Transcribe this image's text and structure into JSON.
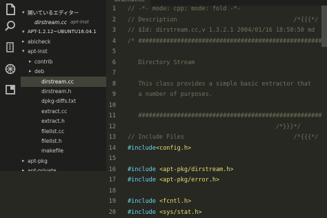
{
  "sidebar": {
    "open_editors_label": "開いているエディター",
    "open_file_name": "dirstream.cc",
    "open_file_folder": "apt-inst",
    "workspace_label": "APT-1.2.12~UBUNTU16.04.1",
    "tree": [
      {
        "label": "abicheck",
        "expanded": false,
        "folder": true
      },
      {
        "label": "apt-inst",
        "expanded": true,
        "folder": true
      },
      {
        "label": "contrib",
        "expanded": false,
        "folder": true
      },
      {
        "label": "deb",
        "expanded": false,
        "folder": true
      },
      {
        "label": "dirstream.cc",
        "selected": true
      },
      {
        "label": "dirstream.h"
      },
      {
        "label": "dpkg-diffs.txt"
      },
      {
        "label": "extract.cc"
      },
      {
        "label": "extract.h"
      },
      {
        "label": "filelist.cc"
      },
      {
        "label": "filelist.h"
      },
      {
        "label": "makefile"
      },
      {
        "label": "apt-pkg",
        "expanded": false,
        "folder": true
      },
      {
        "label": "apt-private",
        "expanded": false,
        "folder": true
      }
    ]
  },
  "activity_icons": [
    "files-icon",
    "search-icon",
    "source-control-icon",
    "debug-icon",
    "extensions-icon"
  ],
  "editor": {
    "lines": [
      {
        "n": "1",
        "parts": [
          {
            "c": "cm",
            "t": "// -*- mode: cpp; mode: fold -*-"
          }
        ]
      },
      {
        "n": "2",
        "parts": [
          {
            "c": "cm",
            "t": "// Description                                 /*{{{*/"
          }
        ]
      },
      {
        "n": "3",
        "parts": [
          {
            "c": "cm",
            "t": "// $Id: dirstream.cc,v 1.3.2.1 2004/01/16 18:58:50 md"
          }
        ]
      },
      {
        "n": "4",
        "parts": [
          {
            "c": "cm",
            "t": "/* ######################################################"
          }
        ]
      },
      {
        "n": "5",
        "parts": [
          {
            "c": "cm",
            "t": ""
          }
        ]
      },
      {
        "n": "6",
        "parts": [
          {
            "c": "cm",
            "t": "   Directory Stream"
          }
        ]
      },
      {
        "n": "7",
        "parts": [
          {
            "c": "cm",
            "t": ""
          }
        ]
      },
      {
        "n": "8",
        "parts": [
          {
            "c": "cm",
            "t": "   This class provides a simple basic extractor that"
          }
        ]
      },
      {
        "n": "9",
        "parts": [
          {
            "c": "cm",
            "t": "   a number of purposes."
          }
        ]
      },
      {
        "n": "10",
        "parts": [
          {
            "c": "cm",
            "t": ""
          }
        ]
      },
      {
        "n": "11",
        "parts": [
          {
            "c": "cm",
            "t": "   ####################################################"
          }
        ]
      },
      {
        "n": "12",
        "parts": [
          {
            "c": "cm",
            "t": "                                          /*}}}*/"
          }
        ]
      },
      {
        "n": "13",
        "parts": [
          {
            "c": "cm",
            "t": "// Include Files                               /*{{{*/"
          }
        ]
      },
      {
        "n": "14",
        "parts": [
          {
            "c": "kw",
            "t": "#include"
          },
          {
            "c": "str",
            "t": "<config.h>"
          }
        ]
      },
      {
        "n": "15",
        "parts": [
          {
            "c": "plain",
            "t": ""
          }
        ]
      },
      {
        "n": "16",
        "parts": [
          {
            "c": "kw",
            "t": "#include "
          },
          {
            "c": "str",
            "t": "<apt-pkg/dirstream.h>"
          }
        ]
      },
      {
        "n": "17",
        "parts": [
          {
            "c": "kw",
            "t": "#include "
          },
          {
            "c": "str",
            "t": "<apt-pkg/error.h>"
          }
        ]
      },
      {
        "n": "18",
        "parts": [
          {
            "c": "plain",
            "t": ""
          }
        ]
      },
      {
        "n": "19",
        "parts": [
          {
            "c": "kw",
            "t": "#include "
          },
          {
            "c": "str",
            "t": "<fcntl.h>"
          }
        ]
      },
      {
        "n": "20",
        "parts": [
          {
            "c": "kw",
            "t": "#include "
          },
          {
            "c": "str",
            "t": "<sys/stat.h>"
          }
        ]
      }
    ]
  },
  "colors": {
    "comment": "#75715e",
    "keyword": "#66d9ef",
    "string": "#e6db74",
    "background": "#272822",
    "sidebar": "#1e1f1c"
  }
}
